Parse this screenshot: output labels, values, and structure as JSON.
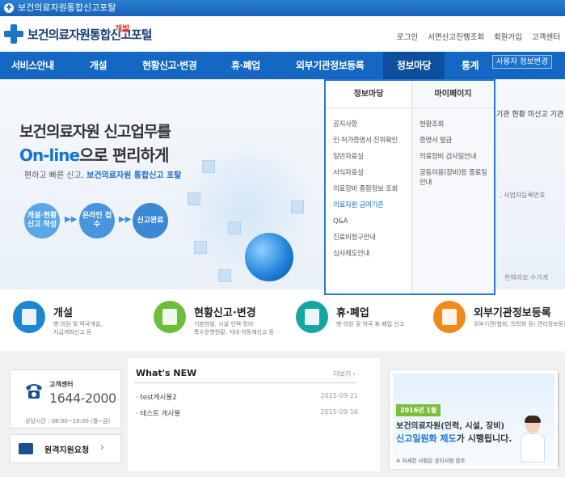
{
  "titlebar": {
    "title": "보건의료자원통합신고포탈"
  },
  "header": {
    "logo_text": "보건의료자원통합신고포털",
    "logo_tag": "개발",
    "util": [
      "로그인",
      "서면신고진행조회",
      "회원가입",
      "고객센터"
    ]
  },
  "gnb": {
    "items": [
      "서비스안내",
      "개설",
      "현황신고·변경",
      "휴·폐업",
      "외부기관정보등록",
      "정보마당",
      "통계"
    ],
    "user_info": "사용자 정보변경"
  },
  "hero": {
    "line1": "보건의료자원 신고업무를",
    "line2_highlight": "On-line",
    "line2_rest": "으로 편리하게",
    "sub_a": "편하고 빠른 신고,",
    "sub_b": "보건의료자원 통합신고 포탈",
    "steps": [
      "개설·현황 신고 작성",
      "온라인 접수",
      "신고완료"
    ]
  },
  "right_partial": {
    "c1": "기관 현황 미신고 기관",
    "c2": ", 사업자등록번호",
    "c3": "한해의료 수가계"
  },
  "dropdown": {
    "col1_title": "정보마당",
    "col1_items": [
      "공지사항",
      "인·허가증명서 진위확인",
      "일반자료실",
      "서식자료실",
      "의료장비 종합정보 조회",
      "의료자원 급여기준",
      "Q&A",
      "진료비청구안내",
      "심사제도안내"
    ],
    "col2_title": "마이페이지",
    "col2_items": [
      "현황조회",
      "증명서 발급",
      "의료장비 검사일안내",
      "공동이용(장비)등 중료일 안내"
    ]
  },
  "services": [
    {
      "title": "개설",
      "desc": "병·의원 및 약국개설,\n지급계좌신고 등",
      "color": "#1b86d1"
    },
    {
      "title": "현황신고·변경",
      "desc": "기본현황, 시설·인력·장비·\n특수운영현황, 식대·처등재신고 등",
      "color": "#6bbf3b"
    },
    {
      "title": "휴·폐업",
      "desc": "병·의원 및 약국 휴·폐업 신고",
      "color": "#17a5a2"
    },
    {
      "title": "외부기관정보등록",
      "desc": "외부기관(협회, 의학회 등) 관리정보등록",
      "color": "#f08a1c"
    }
  ],
  "customer": {
    "label": "고객센터",
    "number": "1644-2000",
    "hours": "상담시간 : 08:00~19:00 (월~금)"
  },
  "remote": {
    "label": "원격지원요청",
    "chevron": "›"
  },
  "news": {
    "title": "What's NEW",
    "more": "더보기 ›",
    "rows": [
      {
        "title": "test게시물2",
        "date": "2015-09-21"
      },
      {
        "title": "테스트 게시물",
        "date": "2015-09-16"
      }
    ]
  },
  "banner": {
    "year": "2016년 1월",
    "line1": "보건의료자원(인력, 시설, 장비)",
    "line2_highlight": "신고일원화 제도",
    "line2_rest": "가 시행됩니다.",
    "note": "※ 자세한 사항은 공지사항 참조"
  }
}
